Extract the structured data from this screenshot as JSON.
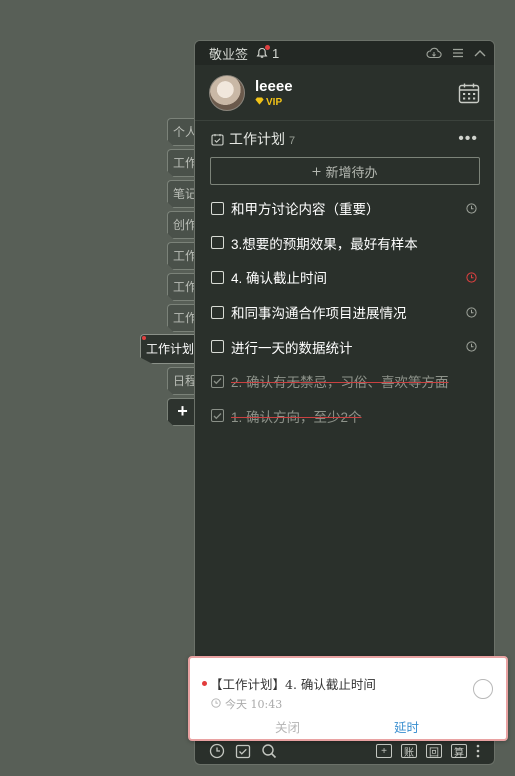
{
  "side_tabs": [
    {
      "label": "个人"
    },
    {
      "label": "工作"
    },
    {
      "label": "笔记"
    },
    {
      "label": "创作"
    },
    {
      "label": "工作"
    },
    {
      "label": "工作"
    },
    {
      "label": "工作"
    },
    {
      "label": "工作计划",
      "active": true
    },
    {
      "label": "日程"
    }
  ],
  "side_add_label": "+",
  "app": {
    "title": "敬业签",
    "reminder_count": "1"
  },
  "profile": {
    "username": "leeee",
    "vip_label": "VIP",
    "vip_color": "#f2c318"
  },
  "list": {
    "name": "工作计划",
    "count": "7",
    "more_label": "•••",
    "add_label": "新增待办"
  },
  "todos": [
    {
      "text": "和甲方讨论内容（重要）",
      "done": false,
      "clock": "gray"
    },
    {
      "text": "3.想要的预期效果，最好有样本",
      "done": false,
      "clock": "none"
    },
    {
      "text": "4. 确认截止时间",
      "done": false,
      "clock": "red"
    },
    {
      "text": "和同事沟通合作项目进展情况",
      "done": false,
      "clock": "gray"
    },
    {
      "text": "进行一天的数据统计",
      "done": false,
      "clock": "gray"
    },
    {
      "text": "2. 确认有无禁忌，习俗、喜欢等方面",
      "done": true,
      "clock": "none"
    },
    {
      "text": "1. 确认方向，至少2个",
      "done": true,
      "clock": "none"
    }
  ],
  "notification": {
    "title": "【工作计划】4. 确认截止时间",
    "time": "今天 10:43",
    "close_label": "关闭",
    "delay_label": "延时"
  },
  "bottom_right_labels": [
    "+",
    "账",
    "回",
    "算"
  ],
  "colors": {
    "background": "#585f57",
    "panel": "#2a302b",
    "alert_red": "#e04040",
    "link_blue": "#3a8fd0"
  }
}
